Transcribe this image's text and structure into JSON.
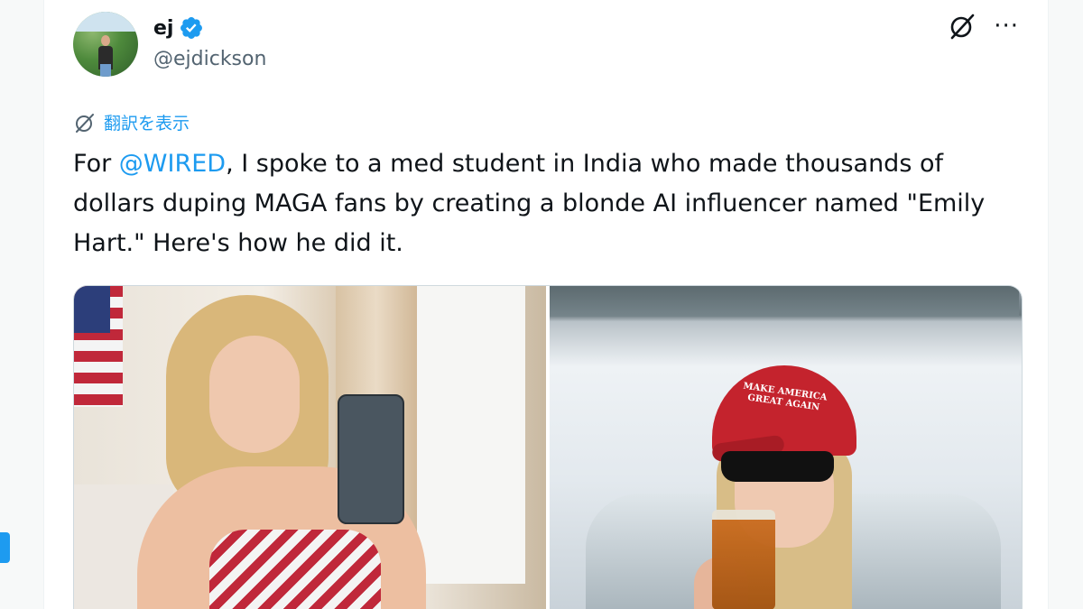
{
  "tweet": {
    "author": {
      "display_name": "ej",
      "handle": "@ejdickson",
      "verified": true
    },
    "translate_label": "翻訳を表示",
    "text_segments": {
      "before_mention": "For ",
      "mention": "@WIRED",
      "after_mention": ", I spoke to a med student in India who made thousands of dollars duping MAGA fans by creating a blonde AI influencer named \"Emily Hart.\" Here's how he did it."
    },
    "media": {
      "image_count": 2,
      "image2_cap_text": "MAKE AMERICA GREAT AGAIN"
    }
  },
  "colors": {
    "accent": "#1d9bf0",
    "text_primary": "#0f1419",
    "text_secondary": "#536471"
  },
  "icons": {
    "verified": "verified-badge-icon",
    "grok": "grok-icon",
    "more": "more-options-icon",
    "translate": "translate-icon"
  }
}
